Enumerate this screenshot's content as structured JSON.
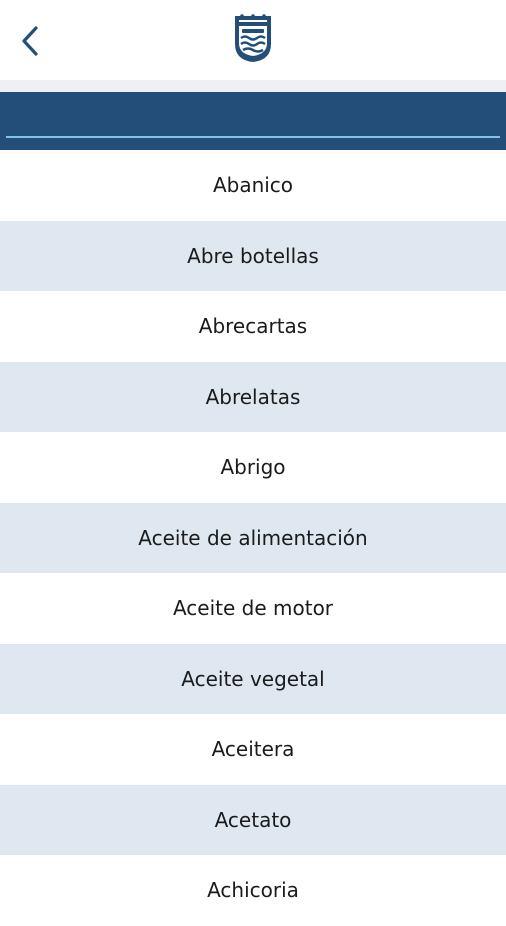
{
  "header": {
    "back_icon": "chevron-left-icon",
    "logo_icon": "coat-of-arms-shield-icon",
    "accent_color": "#234e7a",
    "underline_color": "#7ec4e8"
  },
  "search": {
    "value": "",
    "placeholder": ""
  },
  "items": [
    {
      "label": "Abanico"
    },
    {
      "label": "Abre botellas"
    },
    {
      "label": "Abrecartas"
    },
    {
      "label": "Abrelatas"
    },
    {
      "label": "Abrigo"
    },
    {
      "label": "Aceite de alimentación"
    },
    {
      "label": "Aceite de motor"
    },
    {
      "label": "Aceite vegetal"
    },
    {
      "label": "Aceitera"
    },
    {
      "label": "Acetato"
    },
    {
      "label": "Achicoria"
    }
  ]
}
